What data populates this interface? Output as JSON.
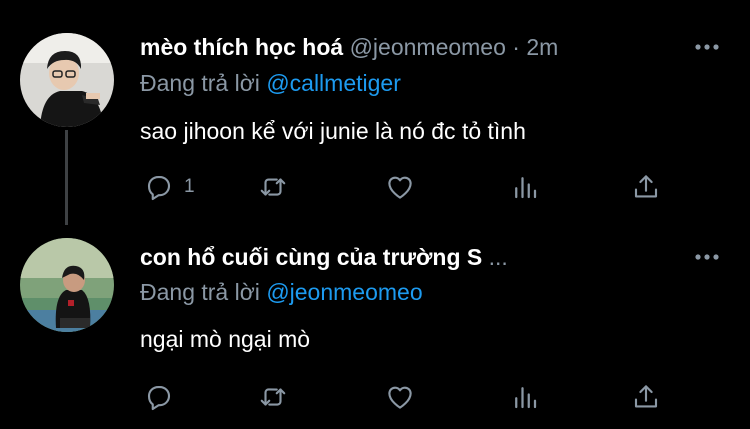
{
  "tweets": [
    {
      "name": "mèo thích học hoá",
      "handle": "@jeonmeomeo",
      "separator": "·",
      "time": "2m",
      "reply_prefix": "Đang trả lời",
      "reply_to": "@callmetiger",
      "text": "sao jihoon kể với junie là nó đc tỏ tình",
      "reply_count": "1"
    },
    {
      "name": "con hổ cuối cùng của trường S",
      "ellipsis": "...",
      "reply_prefix": "Đang trả lời",
      "reply_to": "@jeonmeomeo",
      "text": "ngại mò ngại mò",
      "reply_count": ""
    }
  ],
  "colors": {
    "background": "#000000",
    "link": "#1d9bf0",
    "secondary": "#8b98a5",
    "icon": "#8b98a5"
  },
  "icons": [
    "reply-icon",
    "retweet-icon",
    "like-icon",
    "analytics-icon",
    "share-icon",
    "more-icon"
  ]
}
